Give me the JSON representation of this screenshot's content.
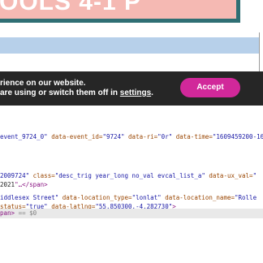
{
  "promo": {
    "headline": "OOLS 4-1 P"
  },
  "cookie_banner": {
    "line1": "rience on our website.",
    "line2_prefix": " are using or switch them off in ",
    "settings_link": "settings",
    "line2_suffix": ".",
    "accept_label": "Accept",
    "accent_color": "#d1289a",
    "background_color": "#262626"
  },
  "devtools": {
    "line1": {
      "p1": "event_9724_0\"",
      "a1": " data-event_id=",
      "v1": "\"9724\"",
      "a2": " data-ri=",
      "v2": "\"0r\"",
      "a3": " data-time=",
      "v3": "\"1609459200-16"
    },
    "line2": {
      "v1": "2009724\"",
      "a1": " class=",
      "v2": "\"desc_trig year_long no_val evcal_list_a\"",
      "a2": " data-ux_val=",
      "v3": "\""
    },
    "line3": {
      "t1": "2021",
      "tag": "\"…</span>"
    },
    "line4": {
      "v1": "iddlesex Street\"",
      "a1": " data-location_type=",
      "v2": "\"lonlat\"",
      "a2": " data-location_name=",
      "v3": "\"Rolle"
    },
    "line5": {
      "a1": "status=",
      "v1": "\"true\"",
      "a2": " data-latlng=",
      "v2": "\"55.850300,-4.282730\"",
      "tag": ">"
    },
    "line6": {
      "tag": "pan>",
      "dim": " == $0"
    }
  }
}
